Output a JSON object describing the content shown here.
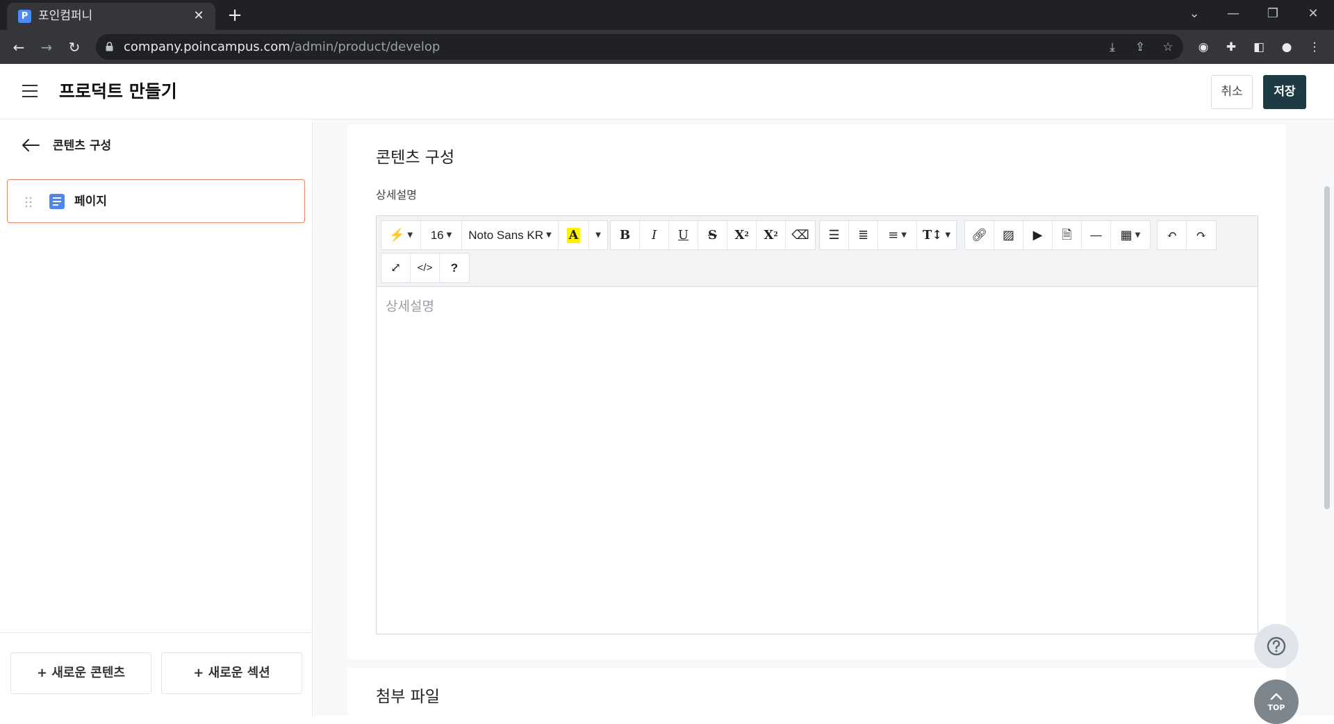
{
  "browser": {
    "tab_title": "포인컴퍼니",
    "favicon_letter": "P",
    "url_host": "company.poincampus.com",
    "url_path": "/admin/product/develop"
  },
  "header": {
    "title": "프로덕트 만들기",
    "cancel_label": "취소",
    "save_label": "저장"
  },
  "sidebar": {
    "back_label": "콘텐츠 구성",
    "items": [
      {
        "label": "페이지",
        "icon": "document-icon"
      }
    ],
    "new_content_label": "+ 새로운 콘텐츠",
    "new_section_label": "+ 새로운 섹션"
  },
  "main": {
    "section_title": "콘텐츠 구성",
    "field_label": "상세설명",
    "editor": {
      "placeholder": "상세설명",
      "font_size": "16",
      "font_family": "Noto Sans KR",
      "highlight_color": "#fff200"
    },
    "attachments_title": "첨부 파일"
  },
  "fab": {
    "top_label": "TOP"
  },
  "colors": {
    "save_button": "#1e3a42",
    "selected_border": "#e0876a",
    "doc_icon": "#4f86e8"
  }
}
